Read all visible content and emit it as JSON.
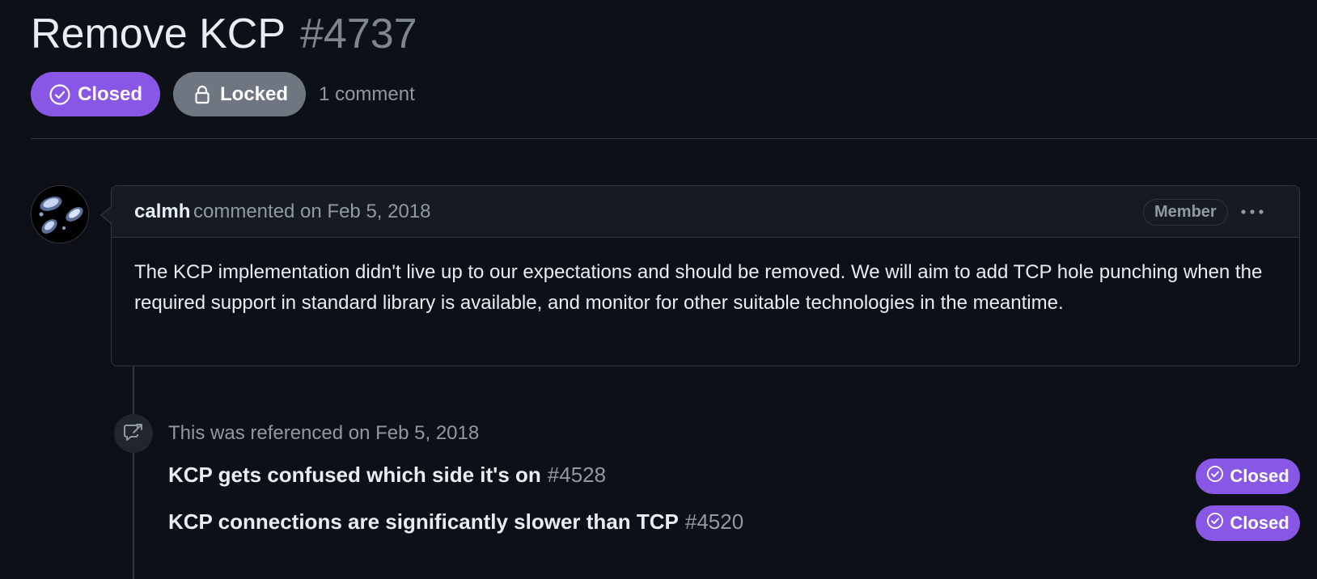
{
  "issue": {
    "title": "Remove KCP",
    "number": "#4737",
    "state": "Closed",
    "locked_label": "Locked",
    "comment_count": "1 comment"
  },
  "comment": {
    "author": "calmh",
    "action": "commented on Feb 5, 2018",
    "role_badge": "Member",
    "body": "The KCP implementation didn't live up to our expectations and should be removed. We will aim to add TCP hole punching when the required support in standard library is available, and monitor for other suitable technologies in the meantime."
  },
  "timeline": {
    "reference_event": "This was referenced on Feb 5, 2018",
    "references": [
      {
        "title": "KCP gets confused which side it's on",
        "number": "#4528",
        "state": "Closed"
      },
      {
        "title": "KCP connections are significantly slower than TCP",
        "number": "#4520",
        "state": "Closed"
      }
    ]
  },
  "colors": {
    "background": "#0d1117",
    "closed_purple": "#8957e5",
    "locked_gray": "#6e7681",
    "muted_text": "#9198a1",
    "border": "#30363d"
  },
  "icons": {
    "closed_state": "check-circle-icon",
    "locked": "lock-icon",
    "more": "kebab-horizontal-icon",
    "reference": "cross-reference-icon"
  }
}
